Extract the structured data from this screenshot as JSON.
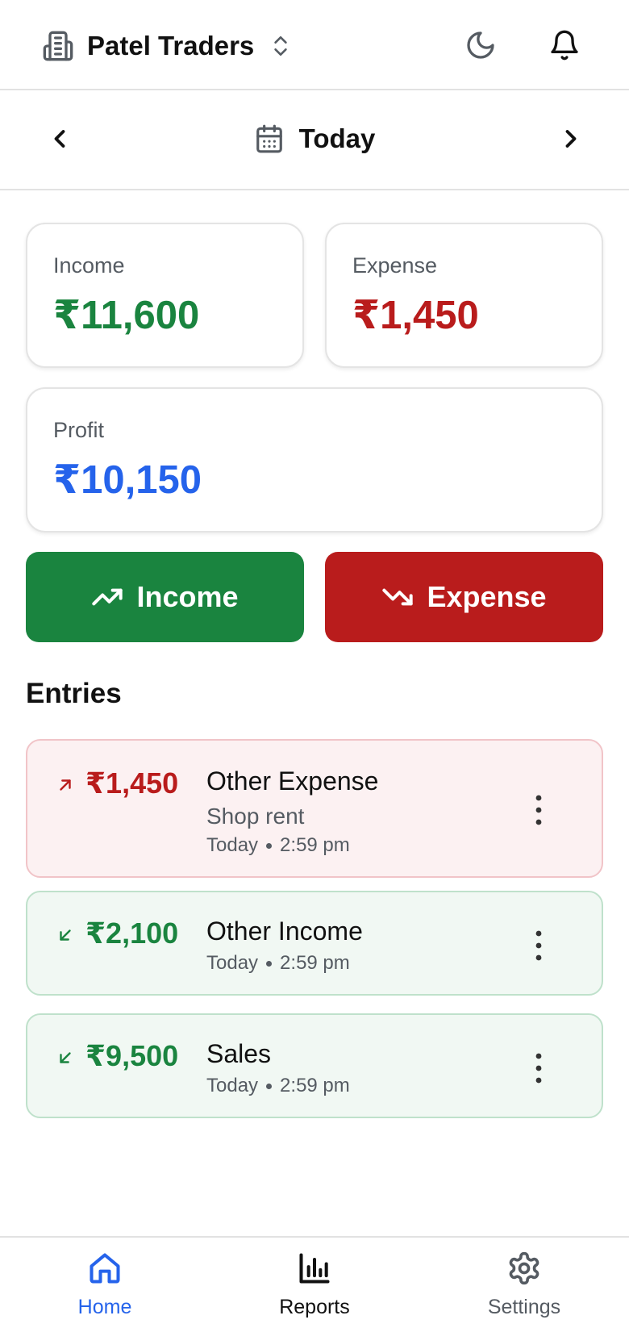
{
  "header": {
    "business_name": "Patel Traders",
    "icons": [
      "building-icon",
      "chevron-up-down-icon",
      "moon-icon",
      "bell-icon"
    ]
  },
  "date_nav": {
    "label": "Today",
    "icons": [
      "chevron-left-icon",
      "calendar-icon",
      "chevron-right-icon"
    ]
  },
  "summary": {
    "income": {
      "label": "Income",
      "amount": "₹11,600"
    },
    "expense": {
      "label": "Expense",
      "amount": "₹1,450"
    },
    "profit": {
      "label": "Profit",
      "amount": "₹10,150"
    }
  },
  "actions": {
    "income_label": "Income",
    "expense_label": "Expense"
  },
  "entries": {
    "title": "Entries",
    "items": [
      {
        "type": "expense",
        "amount": "₹1,450",
        "category": "Other Expense",
        "note": "Shop rent",
        "day": "Today",
        "time": "2:59 pm"
      },
      {
        "type": "income",
        "amount": "₹2,100",
        "category": "Other Income",
        "note": "",
        "day": "Today",
        "time": "2:59 pm"
      },
      {
        "type": "income",
        "amount": "₹9,500",
        "category": "Sales",
        "note": "",
        "day": "Today",
        "time": "2:59 pm"
      }
    ]
  },
  "bottom_nav": {
    "items": [
      {
        "label": "Home",
        "icon": "home-icon",
        "active": true
      },
      {
        "label": "Reports",
        "icon": "bar-chart-icon",
        "active": false
      },
      {
        "label": "Settings",
        "icon": "gear-icon",
        "active": false
      }
    ]
  },
  "colors": {
    "income": "#1a843f",
    "expense": "#b91c1c",
    "profit": "#2563eb",
    "active_nav": "#2563eb"
  }
}
